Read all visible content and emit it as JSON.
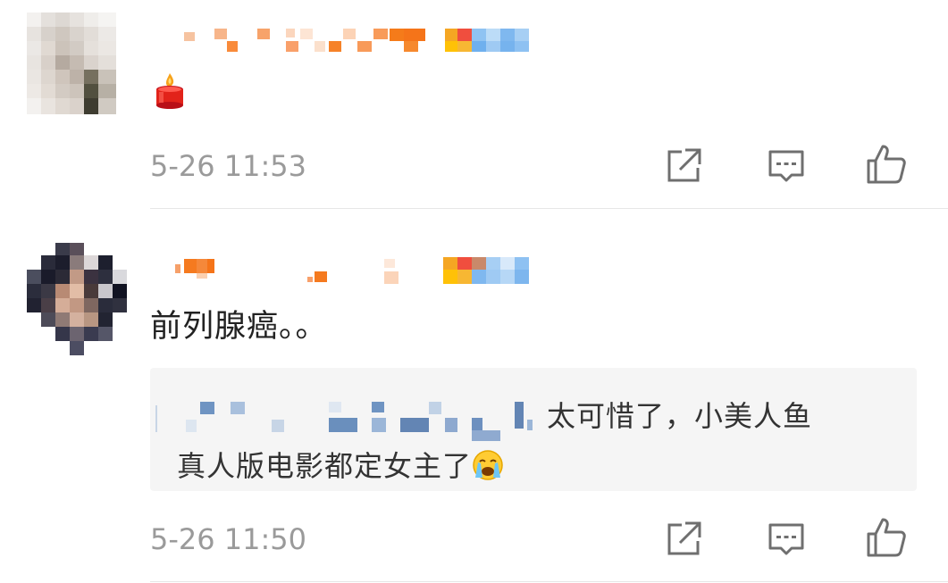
{
  "colors": {
    "timestamp": "#9a9a9a",
    "text": "#222222",
    "quote_bg": "#f5f5f5",
    "icon": "#6f6f6f",
    "divider": "#e6e6e6"
  },
  "comments": [
    {
      "avatar": "pixelated-avatar",
      "username": "",
      "body": "",
      "body_icon": "candle-icon",
      "timestamp": "5-26 11:53",
      "actions": [
        "share-icon",
        "comment-icon",
        "like-icon"
      ]
    },
    {
      "avatar": "pixelated-avatar",
      "username": "",
      "body": "前列腺癌。。",
      "quote": {
        "line1_suffix": "太可惜了，小美人鱼",
        "line2": "真人版电影都定女主了",
        "line2_icon": "crying-face-icon"
      },
      "timestamp": "5-26 11:50",
      "actions": [
        "share-icon",
        "comment-icon",
        "like-icon"
      ]
    }
  ]
}
